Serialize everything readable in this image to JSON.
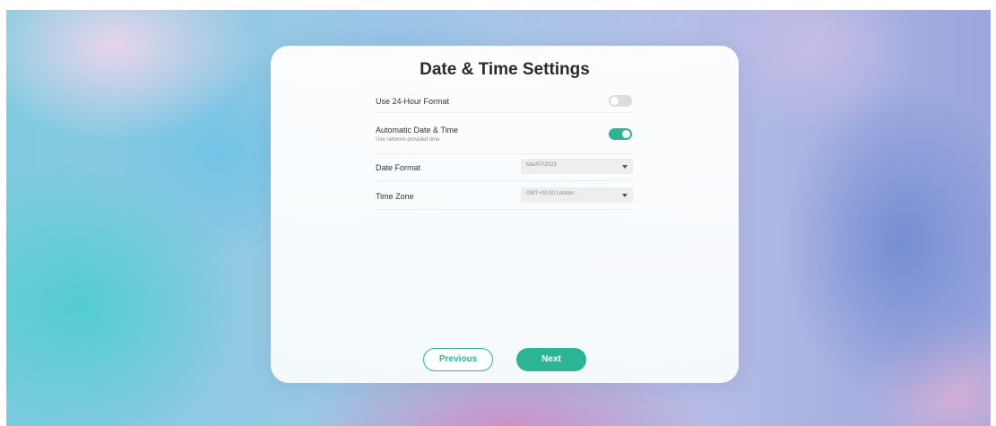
{
  "title": "Date & Time Settings",
  "settings": {
    "hour24": {
      "label": "Use 24-Hour Format",
      "enabled": false
    },
    "auto_time": {
      "label": "Automatic Date & Time",
      "sublabel": "Use network-provided time",
      "enabled": true
    },
    "date_format": {
      "label": "Date Format",
      "value": "Mar/07/2023"
    },
    "time_zone": {
      "label": "Time Zone",
      "value": "GMT+00:00 London"
    }
  },
  "buttons": {
    "previous": "Previous",
    "next": "Next"
  },
  "colors": {
    "accent": "#2bb594",
    "toggle_off": "#dcdcdc"
  },
  "icons": {
    "dropdown": "chevron-down-icon"
  }
}
